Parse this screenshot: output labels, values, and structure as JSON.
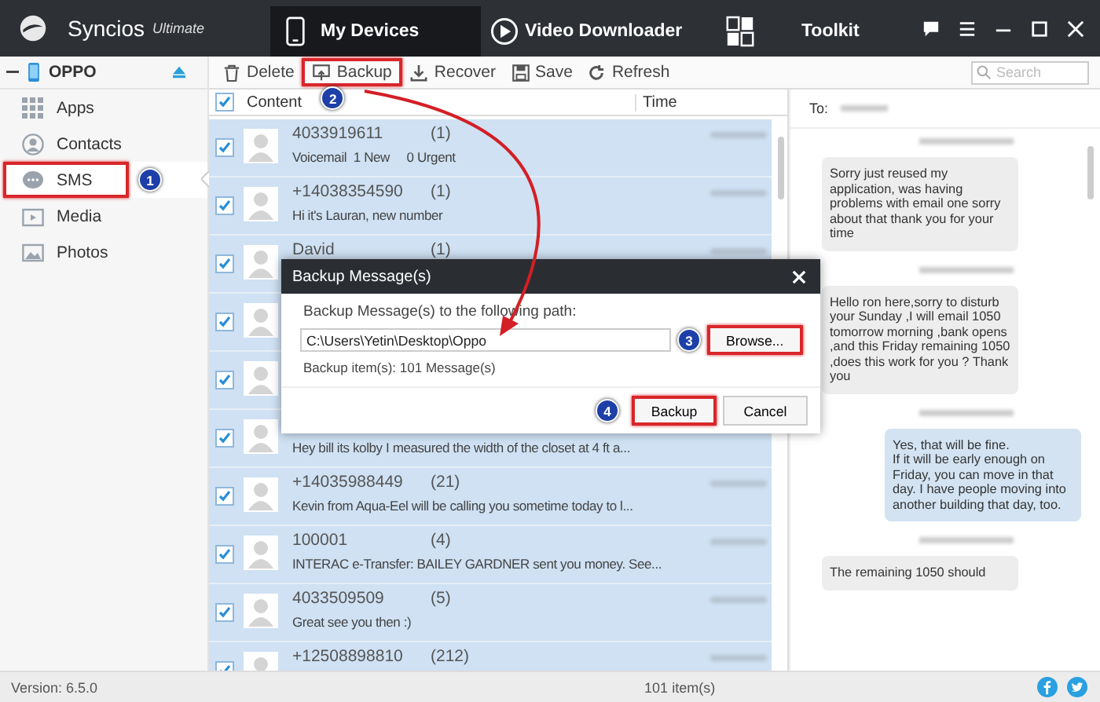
{
  "app": {
    "name": "Syncios",
    "edition": "Ultimate"
  },
  "tabs": [
    {
      "label": "My Devices",
      "selected": true
    },
    {
      "label": "Video Downloader",
      "selected": false
    },
    {
      "label": "Toolkit",
      "selected": false
    }
  ],
  "device": {
    "name": "OPPO"
  },
  "sidebar": {
    "items": [
      {
        "label": "Apps",
        "selected": false,
        "highlighted": false
      },
      {
        "label": "Contacts",
        "selected": false,
        "highlighted": false
      },
      {
        "label": "SMS",
        "selected": true,
        "highlighted": true,
        "badge": "1"
      },
      {
        "label": "Media",
        "selected": false,
        "highlighted": false
      },
      {
        "label": "Photos",
        "selected": false,
        "highlighted": false
      }
    ]
  },
  "toolbar": {
    "buttons": [
      {
        "label": "Delete",
        "highlighted": false
      },
      {
        "label": "Backup",
        "highlighted": true,
        "badge": "2"
      },
      {
        "label": "Recover",
        "highlighted": false
      },
      {
        "label": "Save",
        "highlighted": false
      },
      {
        "label": "Refresh",
        "highlighted": false
      }
    ],
    "search": {
      "placeholder": "Search"
    }
  },
  "table": {
    "columns": [
      "Content",
      "Time"
    ],
    "all_checked": true,
    "rows": [
      {
        "name": "4033919611",
        "count": "(1)",
        "preview": "Voicemail  1 New     0 Urgent",
        "checked": true,
        "selected": true
      },
      {
        "name": "+14038354590",
        "count": "(1)",
        "preview": "Hi it's Lauran, new number",
        "checked": true,
        "selected": true
      },
      {
        "name": "David",
        "count": "(1)",
        "checked": true,
        "selected": true
      },
      {
        "checked": true,
        "selected": true
      },
      {
        "checked": true,
        "selected": true
      },
      {
        "preview": "Hey bill its kolby I measured the width of the closet at 4 ft a...",
        "checked": true,
        "selected": true
      },
      {
        "name": "+14035988449",
        "count": "(21)",
        "preview": "Kevin from Aqua-Eel will be calling you sometime today to l...",
        "checked": true,
        "selected": true
      },
      {
        "name": "100001",
        "count": "(4)",
        "preview": "INTERAC e-Transfer: BAILEY GARDNER sent you money. See...",
        "checked": true,
        "selected": true
      },
      {
        "name": "4033509509",
        "count": "(5)",
        "preview": "Great see you then :)",
        "checked": true,
        "selected": true
      },
      {
        "name": "+12508898810",
        "count": "(212)",
        "checked": true,
        "selected": true
      }
    ]
  },
  "conversation": {
    "to_label": "To:",
    "messages": [
      {
        "kind": "received",
        "text": "Sorry just reused my application, was having problems with email one sorry about that thank you for your time"
      },
      {
        "kind": "received",
        "text": "Hello ron here,sorry to disturb your Sunday ,I will email 1050 tomorrow morning ,bank opens ,and this Friday remaining 1050 ,does this work for you ? Thank you"
      },
      {
        "kind": "sent",
        "text": "Yes, that will be fine.\nIf it will be early enough on Friday, you can move in that day. I have people moving into another building that day, too."
      },
      {
        "kind": "received",
        "text": "The remaining 1050 should"
      }
    ]
  },
  "dialog": {
    "title": "Backup Message(s)",
    "prompt": "Backup Message(s) to the following path:",
    "path": "C:\\Users\\Yetin\\Desktop\\Oppo",
    "browse": {
      "label": "Browse...",
      "highlighted": true,
      "badge": "3"
    },
    "summary": "Backup item(s): 101 Message(s)",
    "buttons": [
      {
        "label": "Backup",
        "highlighted": true,
        "badge": "4"
      },
      {
        "label": "Cancel",
        "highlighted": false
      }
    ]
  },
  "status_bar": {
    "version": "Version: 6.5.0",
    "count": "101 item(s)"
  }
}
